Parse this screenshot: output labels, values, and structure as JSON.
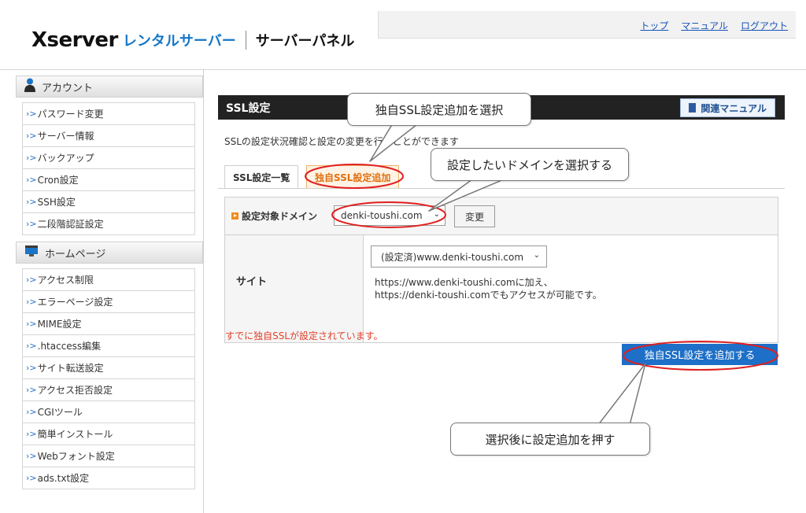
{
  "header": {
    "logo_main": "Xserver",
    "logo_sub": "レンタルサーバー",
    "logo_panel": "サーバーパネル",
    "links": [
      "トップ",
      "マニュアル",
      "ログアウト"
    ]
  },
  "sidebar": {
    "sections": [
      {
        "title": "アカウント",
        "icon": "person-icon",
        "items": [
          "パスワード変更",
          "サーバー情報",
          "バックアップ",
          "Cron設定",
          "SSH設定",
          "二段階認証設定"
        ]
      },
      {
        "title": "ホームページ",
        "icon": "monitor-icon",
        "items": [
          "アクセス制限",
          "エラーページ設定",
          "MIME設定",
          ".htaccess編集",
          "サイト転送設定",
          "アクセス拒否設定",
          "CGIツール",
          "簡単インストール",
          "Webフォント設定",
          "ads.txt設定"
        ]
      }
    ]
  },
  "main": {
    "title": "SSL設定",
    "manual_button": "関連マニュアル",
    "description": "SSLの設定状況確認と設定の変更を行うことができます",
    "tabs": [
      "SSL設定一覧",
      "独自SSL設定追加"
    ],
    "domain_label": "設定対象ドメイン",
    "domain_value": "denki-toushi.com",
    "change_button": "変更",
    "site_label": "サイト",
    "site_value": "(設定済)www.denki-toushi.com",
    "site_note_1": "https://www.denki-toushi.comに加え、",
    "site_note_2": "https://denki-toushi.comでもアクセスが可能です。",
    "status": "すでに独自SSLが設定されています。",
    "add_button": "独自SSL設定を追加する"
  },
  "annotations": {
    "callout_1": "独自SSL設定追加を選択",
    "callout_2": "設定したいドメインを選択する",
    "callout_3": "選択後に設定追加を押す"
  },
  "colors": {
    "accent": "#1d6fc7",
    "title_bar": "#222222",
    "tab_active": "#e07010",
    "status": "#e0402a",
    "highlight_ring": "#e02020"
  }
}
